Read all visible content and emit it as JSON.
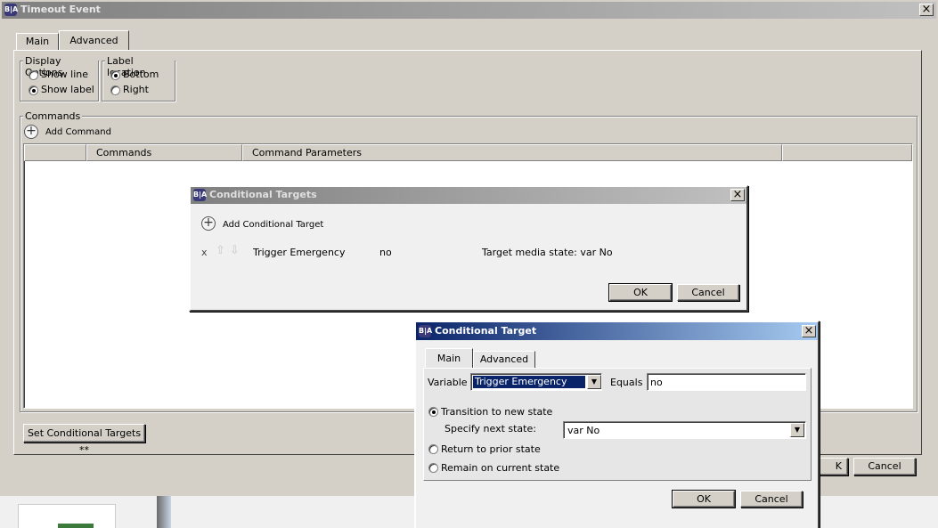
{
  "main_window": {
    "title": "Timeout Event",
    "tabs": [
      "Main",
      "Advanced"
    ],
    "display_options": {
      "legend": "Display Options",
      "show_line": "Show line",
      "show_label": "Show label"
    },
    "label_location": {
      "legend": "Label location",
      "bottom": "Bottom",
      "right": "Right"
    },
    "commands": {
      "legend": "Commands",
      "add_command": "Add Command",
      "columns": [
        "Commands",
        "Command Parameters"
      ]
    },
    "set_conditional_targets": "Set Conditional Targets **",
    "ok_partial": "K",
    "cancel": "Cancel"
  },
  "conditional_targets": {
    "title": "Conditional Targets",
    "add_label": "Add Conditional Target",
    "row": {
      "remove": "x",
      "variable": "Trigger Emergency",
      "value": "no",
      "target": "Target media state: var No"
    },
    "ok": "OK",
    "cancel": "Cancel"
  },
  "conditional_target": {
    "title": "Conditional Target",
    "tabs": [
      "Main",
      "Advanced"
    ],
    "variable_label": "Variable",
    "variable_value": "Trigger Emergency",
    "equals_label": "Equals",
    "equals_value": "no",
    "option_transition": "Transition to new state",
    "specify_label": "Specify next state:",
    "next_state_value": "var No",
    "option_return": "Return to prior state",
    "option_remain": "Remain on current state",
    "ok": "OK",
    "cancel": "Cancel"
  },
  "icon_text": "B|A",
  "colors": {
    "title_active": "#0a246a",
    "title_inactive": "#808080",
    "face": "#d4d0c8",
    "selection": "#0a246a"
  }
}
